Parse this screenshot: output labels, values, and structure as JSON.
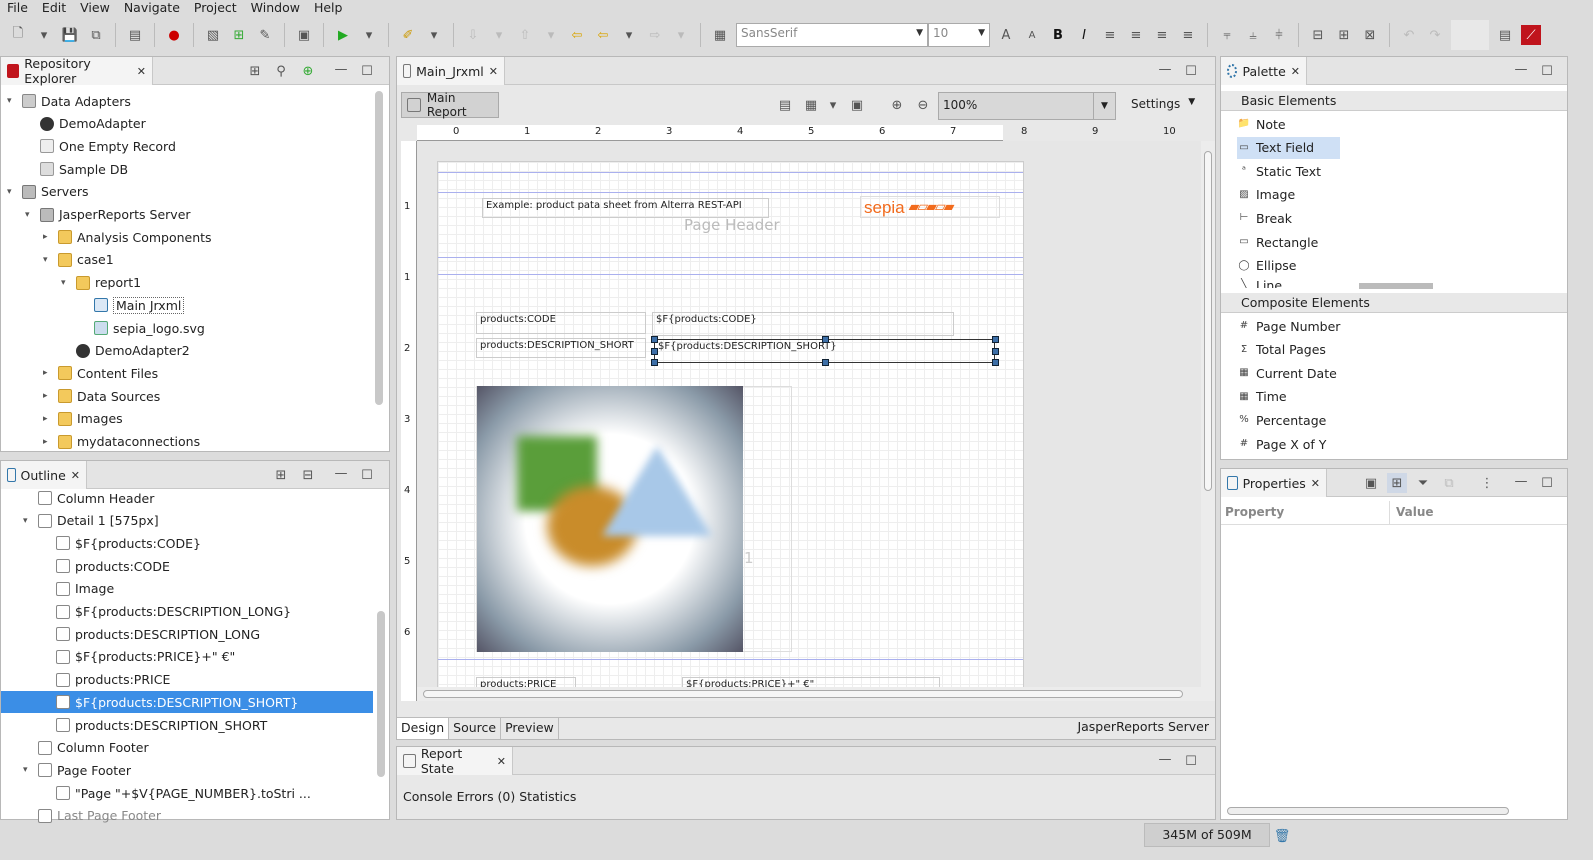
{
  "menu": [
    "File",
    "Edit",
    "View",
    "Navigate",
    "Project",
    "Window",
    "Help"
  ],
  "toolbar": {
    "font": "SansSerif",
    "size": "10",
    "bold": "B",
    "italic": "I",
    "grow": "A",
    "shrink": "A"
  },
  "repo": {
    "title": "Repository Explorer",
    "items": [
      {
        "label": "Data Adapters",
        "level": 0,
        "tw": "▾",
        "icon": "database-icon"
      },
      {
        "label": "DemoAdapter",
        "level": 1,
        "tw": "",
        "icon": "adapter-icon"
      },
      {
        "label": "One Empty Record",
        "level": 1,
        "tw": "",
        "icon": "record-icon"
      },
      {
        "label": "Sample DB",
        "level": 1,
        "tw": "",
        "icon": "db-icon"
      },
      {
        "label": "Servers",
        "level": 0,
        "tw": "▾",
        "icon": "server-icon"
      },
      {
        "label": "JasperReports Server",
        "level": 1,
        "tw": "▾",
        "icon": "server-icon"
      },
      {
        "label": "Analysis Components",
        "level": 2,
        "tw": "▸",
        "icon": "folder-icon"
      },
      {
        "label": "case1",
        "level": 2,
        "tw": "▾",
        "icon": "folder-icon"
      },
      {
        "label": "report1",
        "level": 3,
        "tw": "▾",
        "icon": "folder-icon"
      },
      {
        "label": "Main Jrxml",
        "level": 4,
        "tw": "",
        "icon": "jrxml-icon"
      },
      {
        "label": "sepia_logo.svg",
        "level": 4,
        "tw": "",
        "icon": "image-icon"
      },
      {
        "label": "DemoAdapter2",
        "level": 3,
        "tw": "",
        "icon": "adapter-icon"
      },
      {
        "label": "Content Files",
        "level": 2,
        "tw": "▸",
        "icon": "folder-icon"
      },
      {
        "label": "Data Sources",
        "level": 2,
        "tw": "▸",
        "icon": "folder-icon"
      },
      {
        "label": "Images",
        "level": 2,
        "tw": "▸",
        "icon": "folder-icon"
      },
      {
        "label": "mydataconnections",
        "level": 2,
        "tw": "▸",
        "icon": "folder-icon"
      }
    ]
  },
  "outline": {
    "title": "Outline",
    "items": [
      {
        "label": "Column Header",
        "level": 1,
        "tw": ""
      },
      {
        "label": "Detail 1 [575px]",
        "level": 1,
        "tw": "▾"
      },
      {
        "label": "$F{products:CODE}",
        "level": 2,
        "tw": ""
      },
      {
        "label": "products:CODE",
        "level": 2,
        "tw": ""
      },
      {
        "label": "Image",
        "level": 2,
        "tw": ""
      },
      {
        "label": "$F{products:DESCRIPTION_LONG}",
        "level": 2,
        "tw": ""
      },
      {
        "label": "products:DESCRIPTION_LONG",
        "level": 2,
        "tw": ""
      },
      {
        "label": "$F{products:PRICE}+\" €\"",
        "level": 2,
        "tw": ""
      },
      {
        "label": "products:PRICE",
        "level": 2,
        "tw": ""
      },
      {
        "label": "$F{products:DESCRIPTION_SHORT}",
        "level": 2,
        "tw": "",
        "selected": true
      },
      {
        "label": "products:DESCRIPTION_SHORT",
        "level": 2,
        "tw": ""
      },
      {
        "label": "Column Footer",
        "level": 1,
        "tw": ""
      },
      {
        "label": "Page Footer",
        "level": 1,
        "tw": "▾"
      },
      {
        "label": "\"Page \"+$V{PAGE_NUMBER}.toStri ...",
        "level": 2,
        "tw": ""
      },
      {
        "label": "Last Page Footer",
        "level": 1,
        "tw": ""
      }
    ]
  },
  "editor": {
    "tab": "Main_Jrxml",
    "main_report": "Main Report",
    "zoom": "100%",
    "settings": "Settings",
    "ruler": [
      "0",
      "1",
      "2",
      "3",
      "4",
      "5",
      "6",
      "7",
      "8",
      "9",
      "10"
    ],
    "vruler": [
      "1",
      "1",
      "2",
      "3",
      "4",
      "5",
      "6"
    ],
    "title_text": "Example: product pata sheet from Alterra REST-API",
    "band_page_header": "Page Header",
    "logo": "sepia",
    "code_label": "products:CODE",
    "code_field": "$F{products:CODE}",
    "desc_label": "products:DESCRIPTION_SHORT",
    "desc_field": "$F{products:DESCRIPTION_SHORT}",
    "price_label": "products:PRICE",
    "price_field": "$F{products:PRICE}+\" €\"",
    "detail_band": "1",
    "bottom_tabs": [
      "Design",
      "Source",
      "Preview"
    ],
    "server": "JasperReports Server"
  },
  "report_state": {
    "title": "Report State",
    "content": "Console Errors (0) Statistics"
  },
  "palette": {
    "title": "Palette",
    "basic": "Basic Elements",
    "basic_items": [
      "Note",
      "Text Field",
      "Static Text",
      "Image",
      "Break",
      "Rectangle",
      "Ellipse",
      "Line"
    ],
    "composite": "Composite Elements",
    "composite_items": [
      "Page Number",
      "Total Pages",
      "Current Date",
      "Time",
      "Percentage",
      "Page X of Y"
    ]
  },
  "properties": {
    "title": "Properties",
    "col_property": "Property",
    "col_value": "Value"
  },
  "status": {
    "memory": "345M of 509M"
  },
  "colors": {
    "selection": "#3b8ee6",
    "accent": "#f26b1d"
  }
}
